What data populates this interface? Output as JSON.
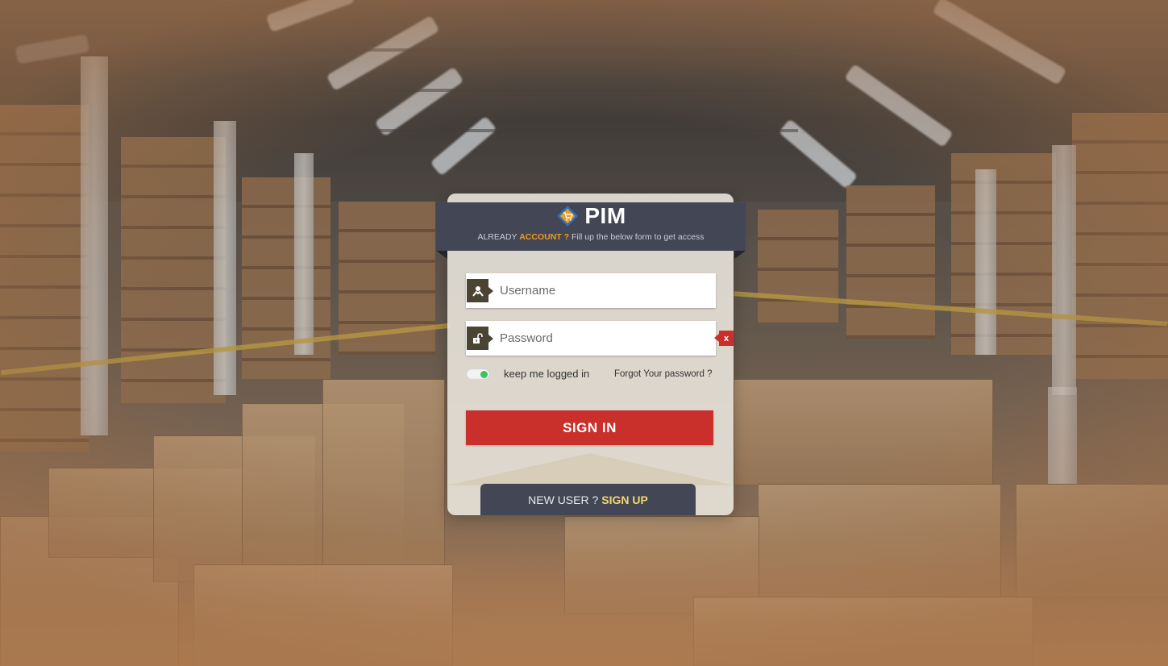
{
  "brand": {
    "name": "PIM",
    "logo_icon": "cart-diamond-icon",
    "tagline_prefix": "ALREADY",
    "tagline_accent": "ACCOUNT ?",
    "tagline_suffix": "Fill up the below form to get access"
  },
  "form": {
    "username_placeholder": "Username",
    "username_value": "",
    "username_icon": "user-icon",
    "password_placeholder": "Password",
    "password_value": "",
    "password_icon": "unlock-icon",
    "password_error": "x",
    "keep_logged_in_label": "keep me logged in",
    "keep_logged_in_on": true,
    "forgot_label": "Forgot Your password ?",
    "signin_label": "SIGN IN"
  },
  "signup": {
    "question": "NEW USER ?",
    "link_label": "SIGN UP"
  },
  "colors": {
    "ribbon": "#434755",
    "accent_orange": "#f29a1b",
    "signin_red": "#c9302c",
    "toggle_green": "#3cc45a",
    "signup_yellow": "#f5d76e"
  }
}
